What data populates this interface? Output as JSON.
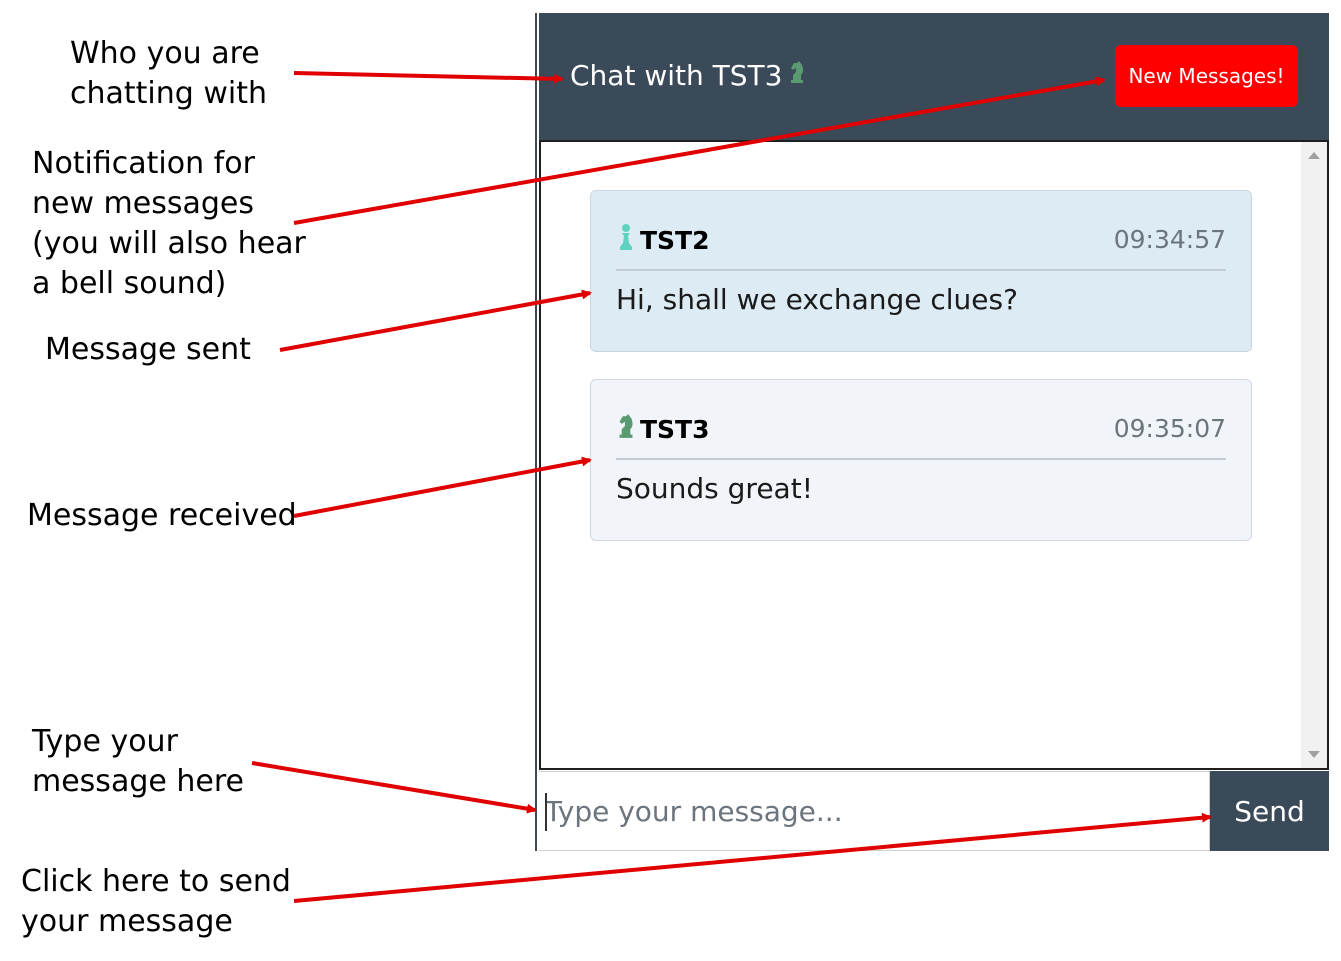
{
  "annotations": {
    "who": "Who you are\nchatting with",
    "notification": "Notification for\nnew messages\n(you will also hear\na bell sound)",
    "sent": "Message sent",
    "received": "Message received",
    "type": "Type your\nmessage here",
    "click": "Click here to send\nyour message"
  },
  "header": {
    "title": "Chat with TST3",
    "title_icon": "knight-icon",
    "new_messages_label": "New Messages!"
  },
  "messages": [
    {
      "user": "TST2",
      "user_icon": "pawn-icon",
      "time": "09:34:57",
      "text": "Hi, shall we exchange clues?"
    },
    {
      "user": "TST3",
      "user_icon": "knight-icon",
      "time": "09:35:07",
      "text": "Sounds great!"
    }
  ],
  "composer": {
    "placeholder": "Type your message...",
    "send_label": "Send"
  },
  "colors": {
    "header_bg": "#3a4a59",
    "alert": "#ff0000",
    "arrow": "#e00000",
    "pawn": "#5fd3c0",
    "knight": "#5a9a70"
  }
}
